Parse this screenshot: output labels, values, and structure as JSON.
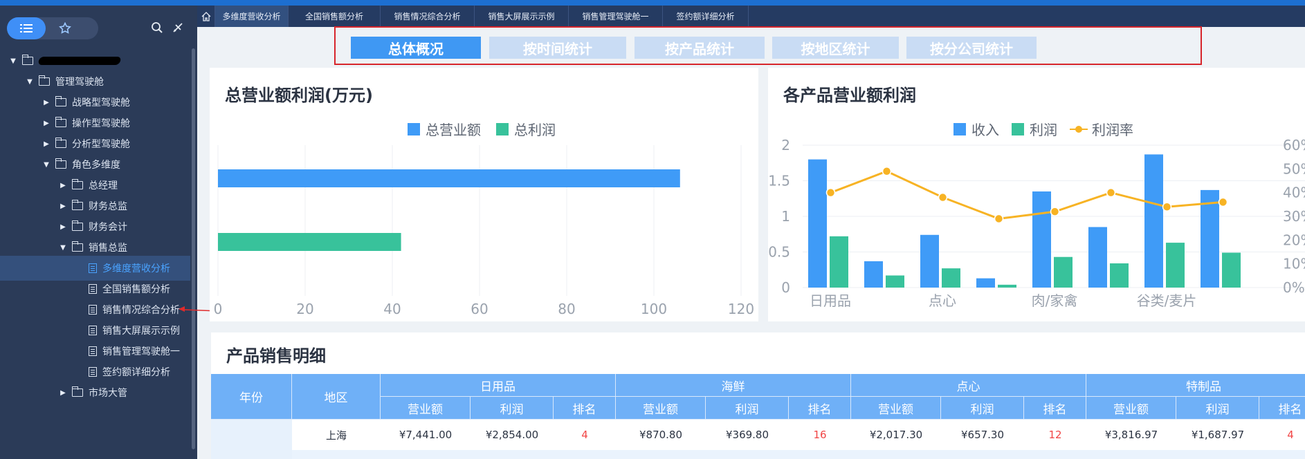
{
  "sidebar": {
    "items": [
      {
        "label": "管理驾驶舱"
      },
      {
        "label": "战略型驾驶舱"
      },
      {
        "label": "操作型驾驶舱"
      },
      {
        "label": "分析型驾驶舱"
      },
      {
        "label": "角色多维度"
      },
      {
        "label": "总经理"
      },
      {
        "label": "财务总监"
      },
      {
        "label": "财务会计"
      },
      {
        "label": "销售总监"
      },
      {
        "label": "多维度营收分析"
      },
      {
        "label": "全国销售额分析"
      },
      {
        "label": "销售情况综合分析"
      },
      {
        "label": "销售大屏展示示例"
      },
      {
        "label": "销售管理驾驶舱一"
      },
      {
        "label": "签约额详细分析"
      },
      {
        "label": "市场大管"
      }
    ]
  },
  "tabs": [
    "多维度营收分析",
    "全国销售额分析",
    "销售情况综合分析",
    "销售大屏展示示例",
    "销售管理驾驶舱一",
    "签约额详细分析"
  ],
  "filters": [
    "总体概况",
    "按时间统计",
    "按产品统计",
    "按地区统计",
    "按分公司统计"
  ],
  "panel1": {
    "title": "总营业额利润(万元)"
  },
  "panel2": {
    "title": "各产品营业额利润"
  },
  "colors": {
    "blue": "#3f9bf7",
    "green": "#38c29b",
    "orange": "#f7b324",
    "header": "#6fb0f7"
  },
  "chart_data": [
    {
      "type": "bar",
      "orientation": "horizontal",
      "categories": [
        "总营业额",
        "总利润"
      ],
      "series": [
        {
          "name": "总营业额",
          "values": [
            106
          ]
        },
        {
          "name": "总利润",
          "values": [
            42
          ]
        }
      ],
      "xlim": [
        0,
        120
      ],
      "xticks": [
        "0",
        "20",
        "40",
        "60",
        "80",
        "100",
        "120"
      ],
      "legend": "top"
    },
    {
      "type": "bar",
      "categories": [
        "日用品",
        "",
        "点心",
        "",
        "肉/家禽",
        "",
        "谷类/麦片",
        ""
      ],
      "series": [
        {
          "name": "收入",
          "values": [
            1.8,
            0.37,
            0.74,
            0.13,
            1.35,
            0.85,
            1.87,
            1.37
          ]
        },
        {
          "name": "利润",
          "values": [
            0.72,
            0.17,
            0.27,
            0.04,
            0.43,
            0.34,
            0.63,
            0.49
          ]
        },
        {
          "name": "利润率",
          "type": "line",
          "axis": "right",
          "values": [
            40,
            49,
            38,
            29,
            32,
            40,
            34,
            36
          ]
        }
      ],
      "ylim": [
        0,
        2
      ],
      "yticks": [
        "0",
        "0.5",
        "1",
        "1.5",
        "2"
      ],
      "y2lim": [
        0,
        60
      ],
      "y2ticks": [
        "0%",
        "10%",
        "20%",
        "30%",
        "40%",
        "50%",
        "60%"
      ],
      "legend": "top"
    }
  ],
  "table": {
    "title": "产品销售明细",
    "col_year": "年份",
    "col_region": "地区",
    "groups": [
      "日用品",
      "海鲜",
      "点心",
      "特制品"
    ],
    "subcols": [
      "营业额",
      "利润",
      "排名"
    ],
    "rows": [
      {
        "region": "上海",
        "cells": [
          "¥7,441.00",
          "¥2,854.00",
          "4",
          "¥870.80",
          "¥369.80",
          "16",
          "¥2,017.30",
          "¥657.30",
          "12",
          "¥3,816.97",
          "¥1,687.97",
          "4"
        ]
      }
    ]
  }
}
